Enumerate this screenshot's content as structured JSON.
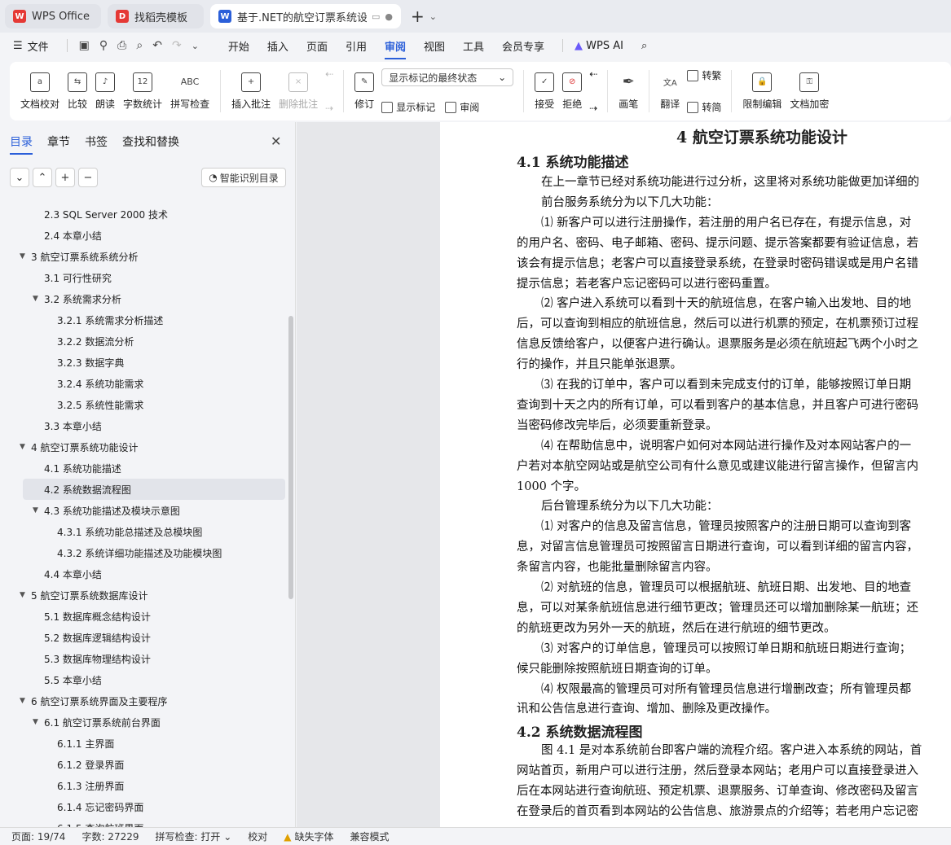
{
  "tabs": [
    {
      "label": "WPS Office",
      "logo_color": "#e53935"
    },
    {
      "label": "找稻壳模板",
      "logo_color": "#e53935"
    },
    {
      "label": "基于.NET的航空订票系统设计",
      "logo_color": "#2b5fd9"
    }
  ],
  "menubar": {
    "file": "文件",
    "items": [
      "开始",
      "插入",
      "页面",
      "引用",
      "审阅",
      "视图",
      "工具",
      "会员专享"
    ],
    "active": "审阅",
    "wps_ai": "WPS AI"
  },
  "ribbon": {
    "doc_check": "文档校对",
    "compare": "比较",
    "read": "朗读",
    "word_count": "字数统计",
    "spell": "拼写检查",
    "insert_comment": "插入批注",
    "delete_comment": "删除批注",
    "revise": "修订",
    "markup_dropdown": "显示标记的最终状态",
    "show_markup": "显示标记",
    "review": "审阅",
    "accept": "接受",
    "reject": "拒绝",
    "pen": "画笔",
    "translate": "翻译",
    "to_traditional": "转繁",
    "to_simplified": "转简",
    "restrict": "限制编辑",
    "encrypt": "文档加密"
  },
  "sidepanel": {
    "tabs": [
      "目录",
      "章节",
      "书签",
      "查找和替换"
    ],
    "smart_btn": "智能识别目录",
    "toc": [
      {
        "text": "2.3 SQL Server 2000 技术",
        "level": 2
      },
      {
        "text": "2.4 本章小结",
        "level": 2
      },
      {
        "text": "3 航空订票系统系统分析",
        "level": 1,
        "expanded": true
      },
      {
        "text": "3.1 可行性研究",
        "level": 2
      },
      {
        "text": "3.2 系统需求分析",
        "level": 2,
        "expanded": true
      },
      {
        "text": "3.2.1 系统需求分析描述",
        "level": 3
      },
      {
        "text": "3.2.2 数据流分析",
        "level": 3
      },
      {
        "text": "3.2.3 数据字典",
        "level": 3
      },
      {
        "text": "3.2.4 系统功能需求",
        "level": 3
      },
      {
        "text": "3.2.5 系统性能需求",
        "level": 3
      },
      {
        "text": "3.3 本章小结",
        "level": 2
      },
      {
        "text": "4 航空订票系统功能设计",
        "level": 1,
        "expanded": true
      },
      {
        "text": "4.1 系统功能描述",
        "level": 2
      },
      {
        "text": "4.2 系统数据流程图",
        "level": 2,
        "selected": true
      },
      {
        "text": "4.3 系统功能描述及模块示意图",
        "level": 2,
        "expanded": true
      },
      {
        "text": "4.3.1 系统功能总描述及总模块图",
        "level": 3
      },
      {
        "text": "4.3.2 系统详细功能描述及功能模块图",
        "level": 3
      },
      {
        "text": "4.4 本章小结",
        "level": 2
      },
      {
        "text": "5 航空订票系统数据库设计",
        "level": 1,
        "expanded": true
      },
      {
        "text": "5.1 数据库概念结构设计",
        "level": 2
      },
      {
        "text": "5.2 数据库逻辑结构设计",
        "level": 2
      },
      {
        "text": "5.3 数据库物理结构设计",
        "level": 2
      },
      {
        "text": "5.5 本章小结",
        "level": 2
      },
      {
        "text": "6 航空订票系统界面及主要程序",
        "level": 1,
        "expanded": true
      },
      {
        "text": "6.1 航空订票系统前台界面",
        "level": 2,
        "expanded": true
      },
      {
        "text": "6.1.1 主界面",
        "level": 3
      },
      {
        "text": "6.1.2 登录界面",
        "level": 3
      },
      {
        "text": "6.1.3 注册界面",
        "level": 3
      },
      {
        "text": "6.1.4 忘记密码界面",
        "level": 3
      },
      {
        "text": "6.1.5 查询航班界面",
        "level": 3
      }
    ]
  },
  "document": {
    "h1": "4 航空订票系统功能设计",
    "h2a": "4.1 系统功能描述",
    "h2b": "4.2 系统数据流程图",
    "lines_a": [
      {
        "text": "在上一章节已经对系统功能进行过分析，这里将对系统功能做更加详细的",
        "indent": true
      },
      {
        "text": "前台服务系统分为以下几大功能：",
        "indent": true
      },
      {
        "text": "⑴ 新客户可以进行注册操作，若注册的用户名已存在，有提示信息，对",
        "indent": true
      },
      {
        "text": "的用户名、密码、电子邮箱、密码、提示问题、提示答案都要有验证信息，若",
        "indent": false
      },
      {
        "text": "该会有提示信息；老客户可以直接登录系统，在登录时密码错误或是用户名错",
        "indent": false
      },
      {
        "text": "提示信息；若老客户忘记密码可以进行密码重置。",
        "indent": false
      },
      {
        "text": "⑵ 客户进入系统可以看到十天的航班信息，在客户输入出发地、目的地",
        "indent": true
      },
      {
        "text": "后，可以查询到相应的航班信息，然后可以进行机票的预定，在机票预订过程",
        "indent": false
      },
      {
        "text": "信息反馈给客户，以便客户进行确认。退票服务是必须在航班起飞两个小时之",
        "indent": false
      },
      {
        "text": "行的操作，并且只能单张退票。",
        "indent": false
      },
      {
        "text": "⑶ 在我的订单中，客户可以看到未完成支付的订单，能够按照订单日期",
        "indent": true
      },
      {
        "text": "查询到十天之内的所有订单，可以看到客户的基本信息，并且客户可进行密码",
        "indent": false
      },
      {
        "text": "当密码修改完毕后，必须要重新登录。",
        "indent": false
      },
      {
        "text": "⑷ 在帮助信息中，说明客户如何对本网站进行操作及对本网站客户的一",
        "indent": true
      },
      {
        "text": "户若对本航空网站或是航空公司有什么意见或建议能进行留言操作，但留言内",
        "indent": false
      },
      {
        "text": "1000 个字。",
        "indent": false
      },
      {
        "text": "后台管理系统分为以下几大功能：",
        "indent": true
      },
      {
        "text": "⑴ 对客户的信息及留言信息，管理员按照客户的注册日期可以查询到客",
        "indent": true
      },
      {
        "text": "息，对留言信息管理员可按照留言日期进行查询，可以看到详细的留言内容，",
        "indent": false
      },
      {
        "text": "条留言内容，也能批量删除留言内容。",
        "indent": false
      },
      {
        "text": "⑵ 对航班的信息，管理员可以根据航班、航班日期、出发地、目的地查",
        "indent": true
      },
      {
        "text": "息，可以对某条航班信息进行细节更改；管理员还可以增加删除某一航班；还",
        "indent": false
      },
      {
        "text": "的航班更改为另外一天的航班，然后在进行航班的细节更改。",
        "indent": false
      },
      {
        "text": "⑶ 对客户的订单信息，管理员可以按照订单日期和航班日期进行查询；",
        "indent": true
      },
      {
        "text": "候只能删除按照航班日期查询的订单。",
        "indent": false
      },
      {
        "text": "⑷ 权限最高的管理员可对所有管理员信息进行增删改查；所有管理员都",
        "indent": true
      },
      {
        "text": "讯和公告信息进行查询、增加、删除及更改操作。",
        "indent": false
      }
    ],
    "lines_b": [
      {
        "text": "图 4.1 是对本系统前台即客户端的流程介绍。客户进入本系统的网站，首",
        "indent": true
      },
      {
        "text": "网站首页，新用户可以进行注册，然后登录本网站；老用户可以直接登录进入",
        "indent": false
      },
      {
        "text": "后在本网站进行查询航班、预定机票、退票服务、订单查询、修改密码及留言",
        "indent": false
      },
      {
        "text": "在登录后的首页看到本网站的公告信息、旅游景点的介绍等；若老用户忘记密",
        "indent": false
      }
    ]
  },
  "status": {
    "page": "页面: 19/74",
    "words": "字数: 27229",
    "spell": "拼写检查: 打开",
    "proof": "校对",
    "missing_font": "缺失字体",
    "compat": "兼容模式"
  }
}
